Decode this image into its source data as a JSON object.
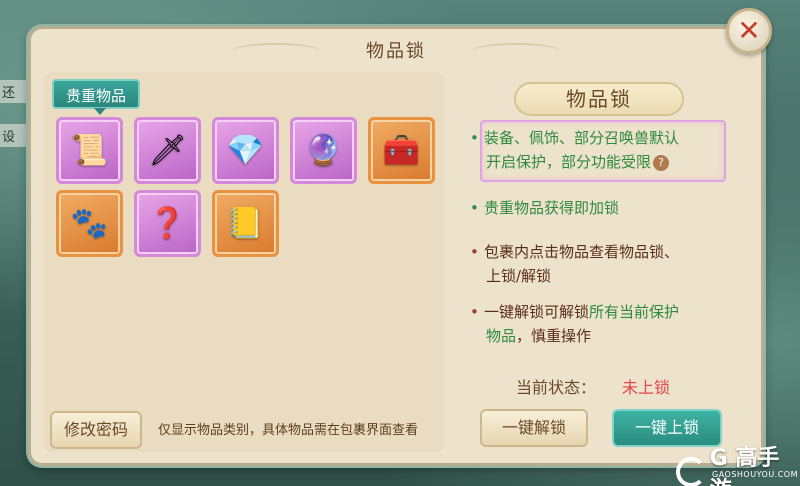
{
  "background": {
    "left_text_1": "还",
    "left_text_2": "设"
  },
  "dialog": {
    "title": "物品锁",
    "close_icon": "close-icon"
  },
  "left_panel": {
    "category_tab": "贵重物品",
    "slots": [
      {
        "icon": "scroll-icon",
        "glyph": "📜",
        "rarity": "purple"
      },
      {
        "icon": "weapon-icon",
        "glyph": "🗡",
        "rarity": "purple"
      },
      {
        "icon": "crystal-icon",
        "glyph": "💎",
        "rarity": "purple"
      },
      {
        "icon": "orb-icon",
        "glyph": "🔮",
        "rarity": "purple"
      },
      {
        "icon": "chest-icon",
        "glyph": "🧰",
        "rarity": "orange"
      },
      {
        "icon": "pet-icon",
        "glyph": "🐾",
        "rarity": "orange"
      },
      {
        "icon": "mystery-icon",
        "glyph": "❓",
        "rarity": "purple"
      },
      {
        "icon": "book-icon",
        "glyph": "📒",
        "rarity": "orange"
      }
    ],
    "change_password_button": "修改密码",
    "note": "仅显示物品类别，具体物品需在包裹界面查看"
  },
  "right_panel": {
    "title": "物品锁",
    "bullet_1_line_1": "装备、佩饰、部分召唤兽默认",
    "bullet_1_line_2": "开启保护，部分功能受限",
    "bullet_2_highlight": "贵重物品",
    "bullet_2_rest": "获得即加锁",
    "bullet_3_line_1": "包裹内点击物品查看物品锁、",
    "bullet_3_line_2": "上锁/解锁",
    "bullet_4_prefix": "一键解锁可解锁",
    "bullet_4_highlight": "所有当前保护",
    "bullet_4_line_2_highlight": "物品",
    "bullet_4_line_2_rest": "，慎重操作",
    "status_label": "当前状态：",
    "status_value": "未上锁",
    "unlock_all_button": "一键解锁",
    "lock_all_button": "一键上锁",
    "help_symbol": "?"
  },
  "watermark": {
    "brand": "G 高手游",
    "site": "GAOSHOUYOU.COM"
  },
  "colors": {
    "accent_teal": "#2a8c80",
    "text_green": "#2d8a3e",
    "status_red": "#e04848",
    "panel_bg": "#ede2cb"
  }
}
